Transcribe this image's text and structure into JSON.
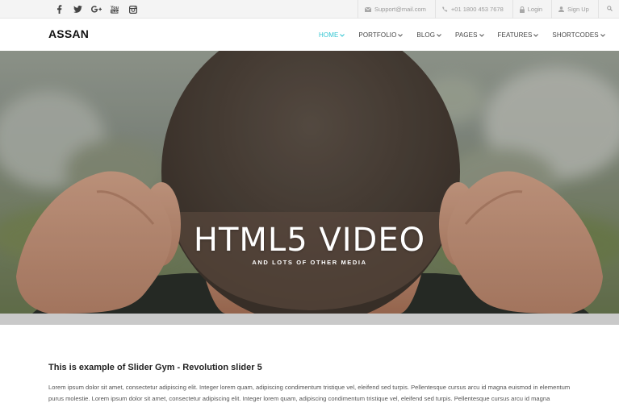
{
  "social": [
    {
      "name": "facebook-icon"
    },
    {
      "name": "twitter-icon"
    },
    {
      "name": "google-plus-icon"
    },
    {
      "name": "youtube-icon"
    },
    {
      "name": "instagram-icon"
    }
  ],
  "topbar": {
    "email": "Support@mail.com",
    "phone": "+01 1800 453 7678",
    "login": "Login",
    "signup": "Sign Up"
  },
  "brand": {
    "logo": "ASSAN"
  },
  "nav": {
    "items": [
      {
        "label": "HOME",
        "active": true
      },
      {
        "label": "PORTFOLIO"
      },
      {
        "label": "BLOG"
      },
      {
        "label": "PAGES"
      },
      {
        "label": "FEATURES"
      },
      {
        "label": "SHORTCODES"
      }
    ],
    "accent": "#32c5d2"
  },
  "hero": {
    "title": "HTML5 VIDEO",
    "subtitle": "AND LOTS OF OTHER MEDIA"
  },
  "content": {
    "title": "This is example of Slider Gym - Revolution slider 5",
    "text": "Lorem ipsum dolor sit amet, consectetur adipiscing elit. Integer lorem quam, adipiscing condimentum tristique vel, eleifend sed turpis. Pellentesque cursus arcu id magna euismod in elementum purus molestie. Lorem ipsum dolor sit amet, consectetur adipiscing elit. Integer lorem quam, adipiscing condimentum tristique vel, eleifend sed turpis. Pellentesque cursus arcu id magna euismod in elementum"
  }
}
